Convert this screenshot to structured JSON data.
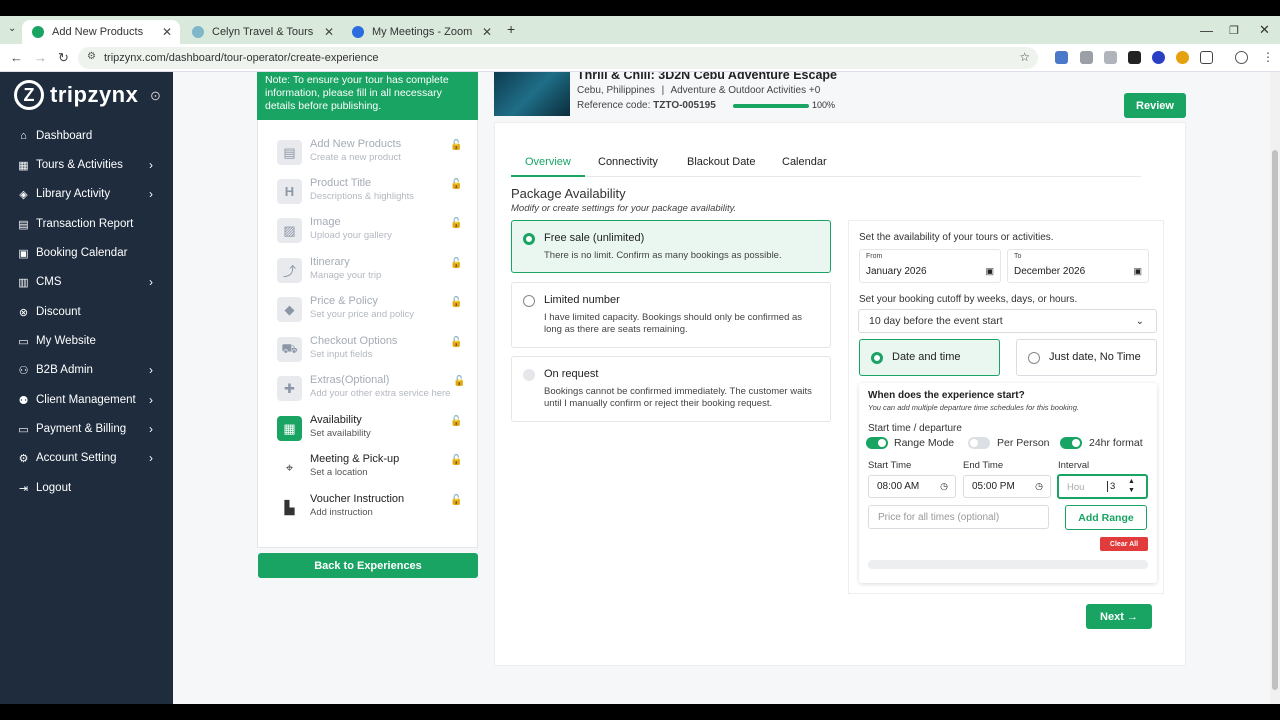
{
  "browser": {
    "tabs": [
      {
        "title": "Add New Products"
      },
      {
        "title": "Celyn Travel & Tours"
      },
      {
        "title": "My Meetings - Zoom"
      }
    ],
    "url": "tripzynx.com/dashboard/tour-operator/create-experience"
  },
  "sidebar": {
    "brand": "tripzynx",
    "items": [
      {
        "label": "Dashboard",
        "icon": "dashboard-icon",
        "has_arrow": false
      },
      {
        "label": "Tours & Activities",
        "icon": "map-icon",
        "has_arrow": true
      },
      {
        "label": "Library Activity",
        "icon": "tag-icon",
        "has_arrow": true
      },
      {
        "label": "Transaction Report",
        "icon": "report-icon",
        "has_arrow": false
      },
      {
        "label": "Booking Calendar",
        "icon": "calendar-icon",
        "has_arrow": false
      },
      {
        "label": "CMS",
        "icon": "cms-icon",
        "has_arrow": true
      },
      {
        "label": "Discount",
        "icon": "discount-icon",
        "has_arrow": false
      },
      {
        "label": "My Website",
        "icon": "globe-icon",
        "has_arrow": false
      },
      {
        "label": "B2B Admin",
        "icon": "users-icon",
        "has_arrow": true
      },
      {
        "label": "Client Management",
        "icon": "client-icon",
        "has_arrow": true
      },
      {
        "label": "Payment & Billing",
        "icon": "payment-icon",
        "has_arrow": true
      },
      {
        "label": "Account Setting",
        "icon": "gear-icon",
        "has_arrow": true
      },
      {
        "label": "Logout",
        "icon": "logout-icon",
        "has_arrow": false
      }
    ]
  },
  "steps": {
    "notice": "Note: To ensure your tour has complete information, please fill in all necessary details before publishing.",
    "items": [
      {
        "title": "Add New Products",
        "subtitle": "Create a new product",
        "state": "done"
      },
      {
        "title": "Product Title",
        "subtitle": "Descriptions & highlights",
        "state": "done"
      },
      {
        "title": "Image",
        "subtitle": "Upload your gallery",
        "state": "done"
      },
      {
        "title": "Itinerary",
        "subtitle": "Manage your trip",
        "state": "done"
      },
      {
        "title": "Price & Policy",
        "subtitle": "Set your price and policy",
        "state": "done"
      },
      {
        "title": "Checkout Options",
        "subtitle": "Set input fields",
        "state": "done"
      },
      {
        "title": "Extras(Optional)",
        "subtitle": "Add your other extra service here",
        "state": "done"
      },
      {
        "title": "Availability",
        "subtitle": "Set availability",
        "state": "active"
      },
      {
        "title": "Meeting & Pick-up",
        "subtitle": "Set a location",
        "state": "pending"
      },
      {
        "title": "Voucher Instruction",
        "subtitle": "Add instruction",
        "state": "pending"
      }
    ],
    "back_label": "Back to Experiences"
  },
  "product": {
    "title": "Thrill & Chill: 3D2N Cebu Adventure Escape",
    "location": "Cebu, Philippines",
    "category": "Adventure & Outdoor Activities +0",
    "ref_label": "Reference code:",
    "ref_code": "TZTO-005195",
    "progress": 100,
    "progress_label": "100%",
    "review_label": "Review"
  },
  "content_tabs": [
    "Overview",
    "Connectivity",
    "Blackout Date",
    "Calendar"
  ],
  "availability": {
    "title": "Package Availability",
    "subtitle": "Modify or create settings for your package availability.",
    "options": [
      {
        "title": "Free sale (unlimited)",
        "desc": "There is no limit. Confirm as many bookings as possible."
      },
      {
        "title": "Limited number",
        "desc": "I have limited capacity. Bookings should only be confirmed as long as there are seats remaining."
      },
      {
        "title": "On request",
        "desc": "Bookings cannot be confirmed immediately. The customer waits until I manually confirm or reject their booking request."
      }
    ]
  },
  "settings": {
    "range_label": "Set the availability of your tours or activities.",
    "from_label": "From",
    "from_value": "January 2026",
    "to_label": "To",
    "to_value": "December 2026",
    "cutoff_label": "Set your booking cutoff by weeks, days, or hours.",
    "cutoff_value": "10 day before the event start",
    "mode_date_time": "Date and time",
    "mode_date_only": "Just date, No Time",
    "exp_heading": "When does the experience start?",
    "exp_sub": "You can add multiple departure time schedules for this booking.",
    "start_time_label": "Start time / departure",
    "toggle_range": "Range Mode",
    "toggle_per_person": "Per Person",
    "toggle_24hr": "24hr format",
    "start_label": "Start Time",
    "start_value": "08:00 AM",
    "end_label": "End Time",
    "end_value": "05:00 PM",
    "interval_label": "Interval",
    "interval_placeholder": "Hou",
    "interval_value": "3",
    "price_placeholder": "Price for all times (optional)",
    "add_range_label": "Add Range",
    "clear_all_label": "Clear All",
    "next_label": "Next →"
  }
}
